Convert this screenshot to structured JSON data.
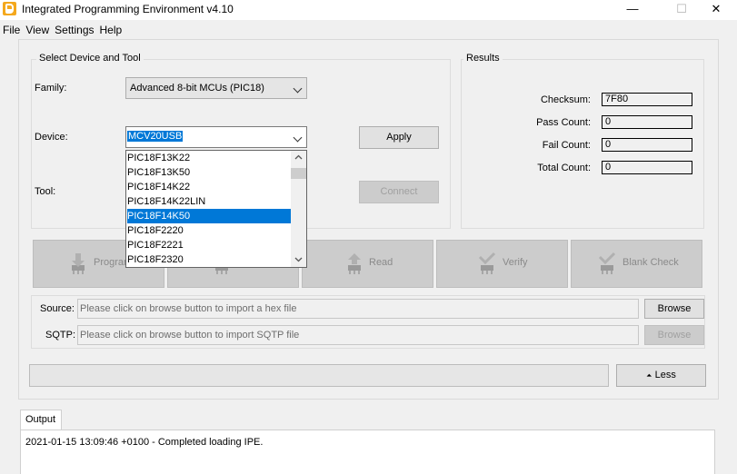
{
  "window": {
    "title": "Integrated Programming Environment v4.10",
    "minimize_glyph": "—",
    "maximize_glyph": "☐",
    "close_glyph": "✕"
  },
  "menu": [
    "File",
    "View",
    "Settings",
    "Help"
  ],
  "device_section": {
    "title": "Select Device and Tool",
    "family_label": "Family:",
    "family_value": "Advanced 8-bit MCUs (PIC18)",
    "device_label": "Device:",
    "device_value": "MCV20USB",
    "tool_label": "Tool:",
    "apply_label": "Apply",
    "connect_label": "Connect",
    "device_options": [
      "PIC18F13K22",
      "PIC18F13K50",
      "PIC18F14K22",
      "PIC18F14K22LIN",
      "PIC18F14K50",
      "PIC18F2220",
      "PIC18F2221",
      "PIC18F2320"
    ],
    "highlighted_option": "PIC18F14K50"
  },
  "results": {
    "title": "Results",
    "checksum_label": "Checksum:",
    "checksum_value": "7F80",
    "pass_label": "Pass Count:",
    "pass_value": "0",
    "fail_label": "Fail Count:",
    "fail_value": "0",
    "total_label": "Total Count:",
    "total_value": "0"
  },
  "actions": {
    "program": "Program",
    "read": "Read",
    "verify": "Verify",
    "blank_check": "Blank Check"
  },
  "source": {
    "label": "Source:",
    "placeholder": "Please click on browse button to import a hex file",
    "browse_label": "Browse"
  },
  "sqtp": {
    "label": "SQTP:",
    "placeholder": "Please click on browse button to import SQTP file",
    "browse_label": "Browse"
  },
  "less_button": "Less",
  "less_glyph": "⏶",
  "output": {
    "tab_label": "Output",
    "log": "2021-01-15 13:09:46 +0100 - Completed loading IPE."
  },
  "colors": {
    "selection": "#0078d7",
    "app_icon": "#f4a81d",
    "disabled_tile": "#cccccc"
  }
}
